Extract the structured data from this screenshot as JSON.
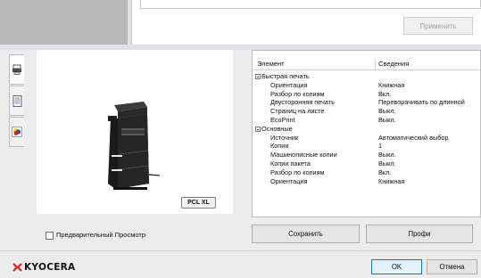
{
  "top": {
    "apply_label": "Применить"
  },
  "tabs": [
    {
      "name": "printer-tab",
      "icon": "printer-icon"
    },
    {
      "name": "document-tab",
      "icon": "document-icon"
    },
    {
      "name": "color-tab",
      "icon": "color-palette-icon"
    }
  ],
  "preview": {
    "pdl_badge": "PCL XL"
  },
  "properties": {
    "header": {
      "item": "Элемент",
      "details": "Сведения"
    },
    "rows": [
      {
        "type": "group",
        "label": "Быстрая печать",
        "value": ""
      },
      {
        "type": "item",
        "label": "Ориентация",
        "value": "Книжная"
      },
      {
        "type": "item",
        "label": "Разбор по копиям",
        "value": "Вкл."
      },
      {
        "type": "item",
        "label": "Двусторонняя печать",
        "value": "Переворачивать по длинной"
      },
      {
        "type": "item",
        "label": "Страниц на листе",
        "value": "Выкл."
      },
      {
        "type": "item",
        "label": "EcoPrint",
        "value": "Выкл."
      },
      {
        "type": "group",
        "label": "Основные",
        "value": ""
      },
      {
        "type": "item",
        "label": "Источник",
        "value": "Автоматический выбор"
      },
      {
        "type": "item",
        "label": "Копии",
        "value": "1"
      },
      {
        "type": "item",
        "label": "Машинописные копии",
        "value": "Выкл."
      },
      {
        "type": "item",
        "label": "Копии пакета",
        "value": "Выкл."
      },
      {
        "type": "item",
        "label": "Разбор по копиям",
        "value": "Вкл."
      },
      {
        "type": "item",
        "label": "Ориентация",
        "value": "Книжная"
      }
    ]
  },
  "preview_checkbox": {
    "label": "Предварительный Просмотр",
    "checked": false
  },
  "buttons": {
    "save": "Сохранить",
    "profiles": "Профи",
    "ok": "OK",
    "cancel": "Отмена"
  },
  "brand": {
    "name": "KYOCERA",
    "accent": "#e1251b"
  }
}
